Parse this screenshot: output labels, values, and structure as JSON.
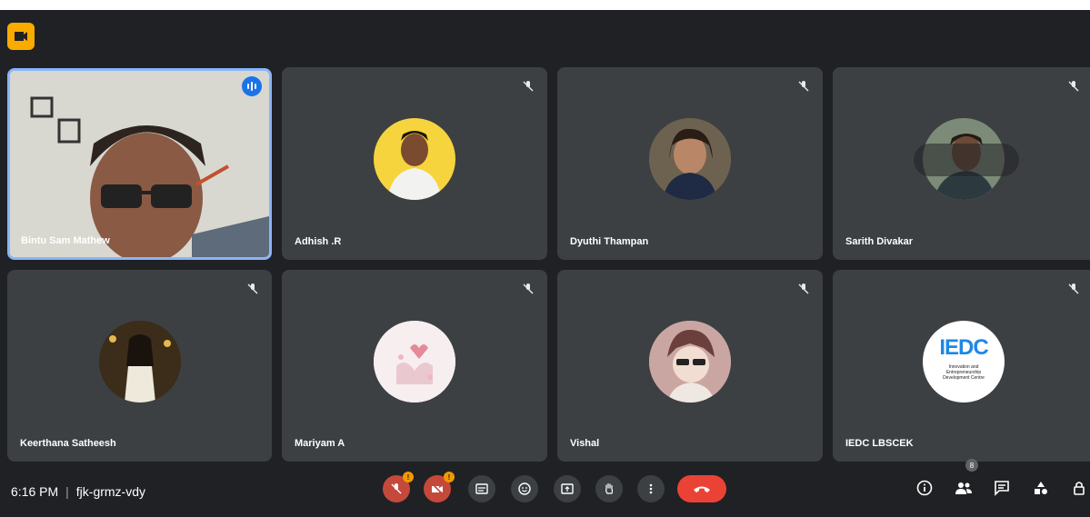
{
  "meeting": {
    "time": "6:16 PM",
    "separator": "|",
    "code": "fjk-grmz-vdy"
  },
  "participants": [
    {
      "name": "Bintu Sam Mathew",
      "speaking": true
    },
    {
      "name": "Adhish .R",
      "muted": true
    },
    {
      "name": "Dyuthi Thampan",
      "muted": true
    },
    {
      "name": "Sarith Divakar",
      "muted": true
    },
    {
      "name": "Keerthana Satheesh",
      "muted": true
    },
    {
      "name": "Mariyam A",
      "muted": true
    },
    {
      "name": "Vishal",
      "muted": true
    },
    {
      "name": "IEDC LBSCEK",
      "muted": true
    }
  ],
  "iedc_logo": {
    "big_text": "IEDC",
    "sub_text": "Innovation and Entrepreneurship Development Centre"
  },
  "controls": {
    "mic_badge": "!",
    "camera_badge": "!",
    "people_count": "8"
  },
  "colors": {
    "background": "#202124",
    "tile": "#3c4043",
    "active_border": "#8ab4f8",
    "end_call": "#ea4335",
    "warning": "#f29900"
  }
}
